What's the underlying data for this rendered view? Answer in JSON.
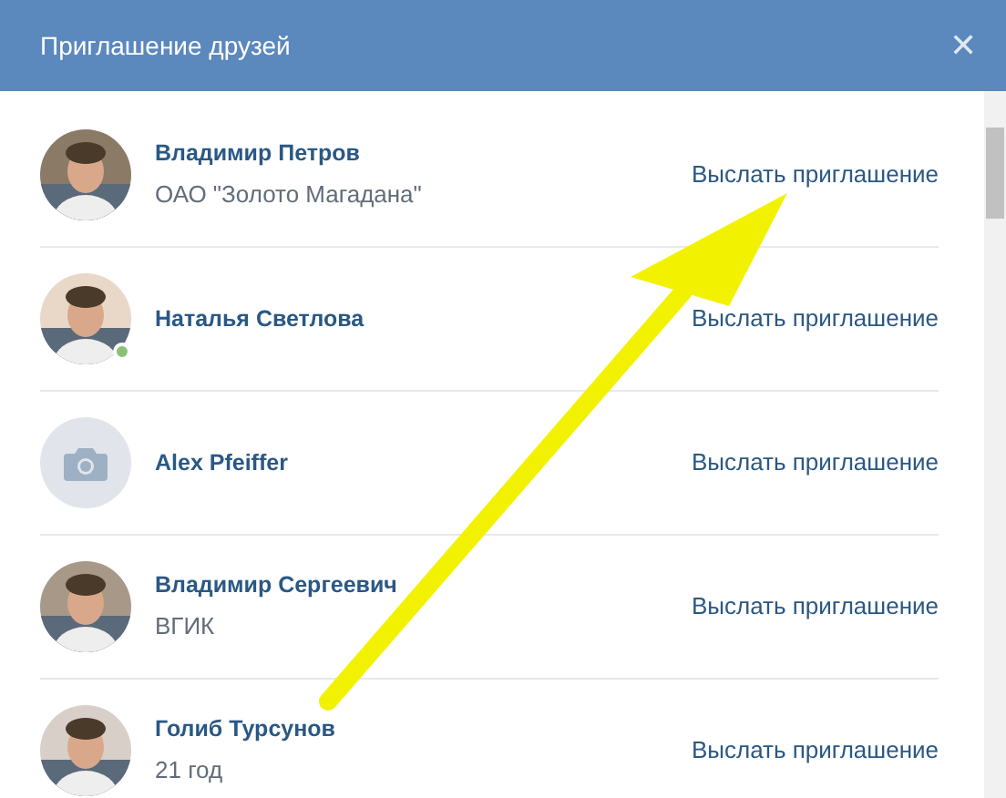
{
  "window": {
    "title": "Приглашение друзей",
    "close": "✕"
  },
  "friends": [
    {
      "name": "Владимир Петров",
      "subtitle": "ОАО \"Золото Магадана\"",
      "online": false,
      "action": "Выслать приглашение"
    },
    {
      "name": "Наталья Светлова",
      "online": true,
      "action": "Выслать приглашение"
    },
    {
      "name": "Alex Pfeiffer",
      "kind": "placeholder",
      "online": false,
      "action": "Выслать приглашение"
    },
    {
      "name": "Владимир Сергеевич",
      "subtitle": "ВГИК",
      "online": false,
      "action": "Выслать приглашение"
    },
    {
      "name": "Голиб Турсунов",
      "subtitle": "21 год",
      "online": false,
      "action": "Выслать приглашение"
    }
  ]
}
